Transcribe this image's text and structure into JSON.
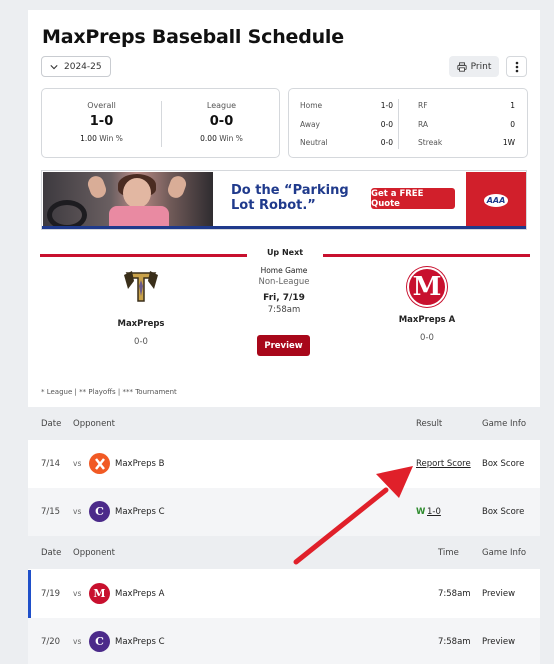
{
  "page": {
    "title": "MaxPreps Baseball Schedule"
  },
  "controls": {
    "season": "2024-25",
    "print_label": "Print"
  },
  "record": {
    "overall_label": "Overall",
    "overall": "1-0",
    "overall_pct": "1.00",
    "overall_pct_label": "Win %",
    "league_label": "League",
    "league": "0-0",
    "league_pct": "0.00",
    "league_pct_label": "Win %"
  },
  "splits": {
    "left": [
      {
        "label": "Home",
        "value": "1-0"
      },
      {
        "label": "Away",
        "value": "0-0"
      },
      {
        "label": "Neutral",
        "value": "0-0"
      }
    ],
    "right": [
      {
        "label": "RF",
        "value": "1"
      },
      {
        "label": "RA",
        "value": "0"
      },
      {
        "label": "Streak",
        "value": "1W"
      }
    ]
  },
  "ad": {
    "headline": "Do the “Parking Lot Robot.”",
    "cta": "Get a FREE Quote",
    "brand": "AAA"
  },
  "up_next": {
    "heading": "Up Next",
    "home": {
      "name": "MaxPreps",
      "record": "0-0"
    },
    "away": {
      "name": "MaxPreps A",
      "record": "0-0",
      "logo_letter": "M"
    },
    "game_type": "Home Game",
    "league_type": "Non-League",
    "date": "Fri, 7/19",
    "time": "7:58am",
    "button": "Preview"
  },
  "legend": "* League | ** Playoffs | *** Tournament",
  "past": {
    "headers": {
      "date": "Date",
      "opponent": "Opponent",
      "result": "Result",
      "info": "Game Info"
    },
    "rows": [
      {
        "date": "7/14",
        "vs": "vs",
        "opponent": "MaxPreps B",
        "result": "Report Score",
        "info": "Box Score",
        "logo_color": "#f15a24",
        "logo_letter": "X"
      },
      {
        "date": "7/15",
        "vs": "vs",
        "opponent": "MaxPreps C",
        "result_wl": "W",
        "result": "1-0",
        "info": "Box Score",
        "logo_color": "#4b2a8a",
        "logo_letter": "C"
      }
    ]
  },
  "upcoming": {
    "headers": {
      "date": "Date",
      "opponent": "Opponent",
      "time": "Time",
      "info": "Game Info"
    },
    "rows": [
      {
        "date": "7/19",
        "vs": "vs",
        "opponent": "MaxPreps A",
        "time": "7:58am",
        "info": "Preview",
        "logo_color": "#c8102e",
        "logo_letter": "M"
      },
      {
        "date": "7/20",
        "vs": "vs",
        "opponent": "MaxPreps C",
        "time": "7:58am",
        "info": "Preview",
        "logo_color": "#4b2a8a",
        "logo_letter": "C"
      }
    ]
  },
  "colors": {
    "accent_red": "#c8102e",
    "button_red": "#a8071a",
    "win_green": "#2e8b2e",
    "annotation_arrow": "#e0202a"
  }
}
